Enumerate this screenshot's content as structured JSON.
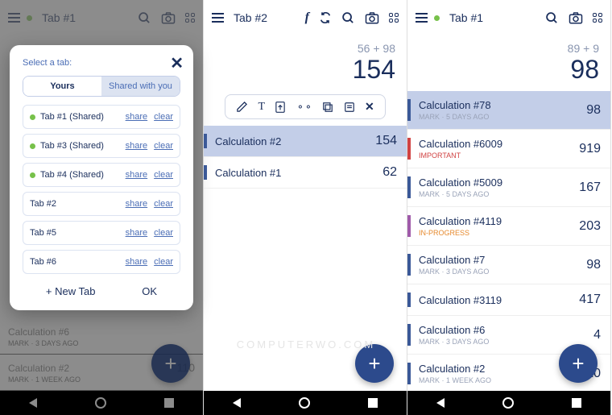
{
  "panel1": {
    "topbar": {
      "title": "Tab #1"
    },
    "bgRows": [
      {
        "title": "Calculation #6",
        "sub": "MARK · 3 DAYS AGO",
        "val": ""
      },
      {
        "title": "Calculation #2",
        "sub": "MARK · 1 WEEK AGO",
        "val": "110"
      }
    ],
    "modal": {
      "label": "Select a tab:",
      "segYours": "Yours",
      "segShared": "Shared with you",
      "shareLabel": "share",
      "clearLabel": "clear",
      "tabs": [
        {
          "name": "Tab #1 (Shared)",
          "dot": true
        },
        {
          "name": "Tab #3 (Shared)",
          "dot": true
        },
        {
          "name": "Tab #4 (Shared)",
          "dot": true
        },
        {
          "name": "Tab #2",
          "dot": false
        },
        {
          "name": "Tab #5",
          "dot": false
        },
        {
          "name": "Tab #6",
          "dot": false
        }
      ],
      "newTab": "+ New Tab",
      "ok": "OK"
    }
  },
  "panel2": {
    "topbar": {
      "title": "Tab #2"
    },
    "expr": "56 + 98",
    "result": "154",
    "rows": [
      {
        "title": "Calculation #2",
        "val": "154",
        "accent": "blue",
        "selected": true
      },
      {
        "title": "Calculation #1",
        "val": "62",
        "accent": "blue",
        "selected": false
      }
    ]
  },
  "panel3": {
    "topbar": {
      "title": "Tab #1"
    },
    "expr": "89 + 9",
    "result": "98",
    "rows": [
      {
        "title": "Calculation #78",
        "sub": "MARK · 5 DAYS AGO",
        "subColor": "",
        "val": "98",
        "accent": "blue",
        "selected": true
      },
      {
        "title": "Calculation #6009",
        "sub": "IMPORTANT",
        "subColor": "red",
        "val": "919",
        "accent": "red",
        "selected": false
      },
      {
        "title": "Calculation #5009",
        "sub": "MARK · 5 DAYS AGO",
        "subColor": "",
        "val": "167",
        "accent": "blue",
        "selected": false
      },
      {
        "title": "Calculation #4119",
        "sub": "IN-PROGRESS",
        "subColor": "orange",
        "val": "203",
        "accent": "purple",
        "selected": false
      },
      {
        "title": "Calculation #7",
        "sub": "MARK · 3 DAYS AGO",
        "subColor": "",
        "val": "98",
        "accent": "blue",
        "selected": false
      },
      {
        "title": "Calculation #3119",
        "sub": "",
        "subColor": "",
        "val": "417",
        "accent": "blue",
        "selected": false
      },
      {
        "title": "Calculation #6",
        "sub": "MARK · 3 DAYS AGO",
        "subColor": "",
        "val": "4",
        "accent": "blue",
        "selected": false
      },
      {
        "title": "Calculation #2",
        "sub": "MARK · 1 WEEK AGO",
        "subColor": "",
        "val": "110",
        "accent": "blue",
        "selected": false
      }
    ]
  },
  "fabLabel": "+",
  "watermark": "COMPUTERWO.COM"
}
